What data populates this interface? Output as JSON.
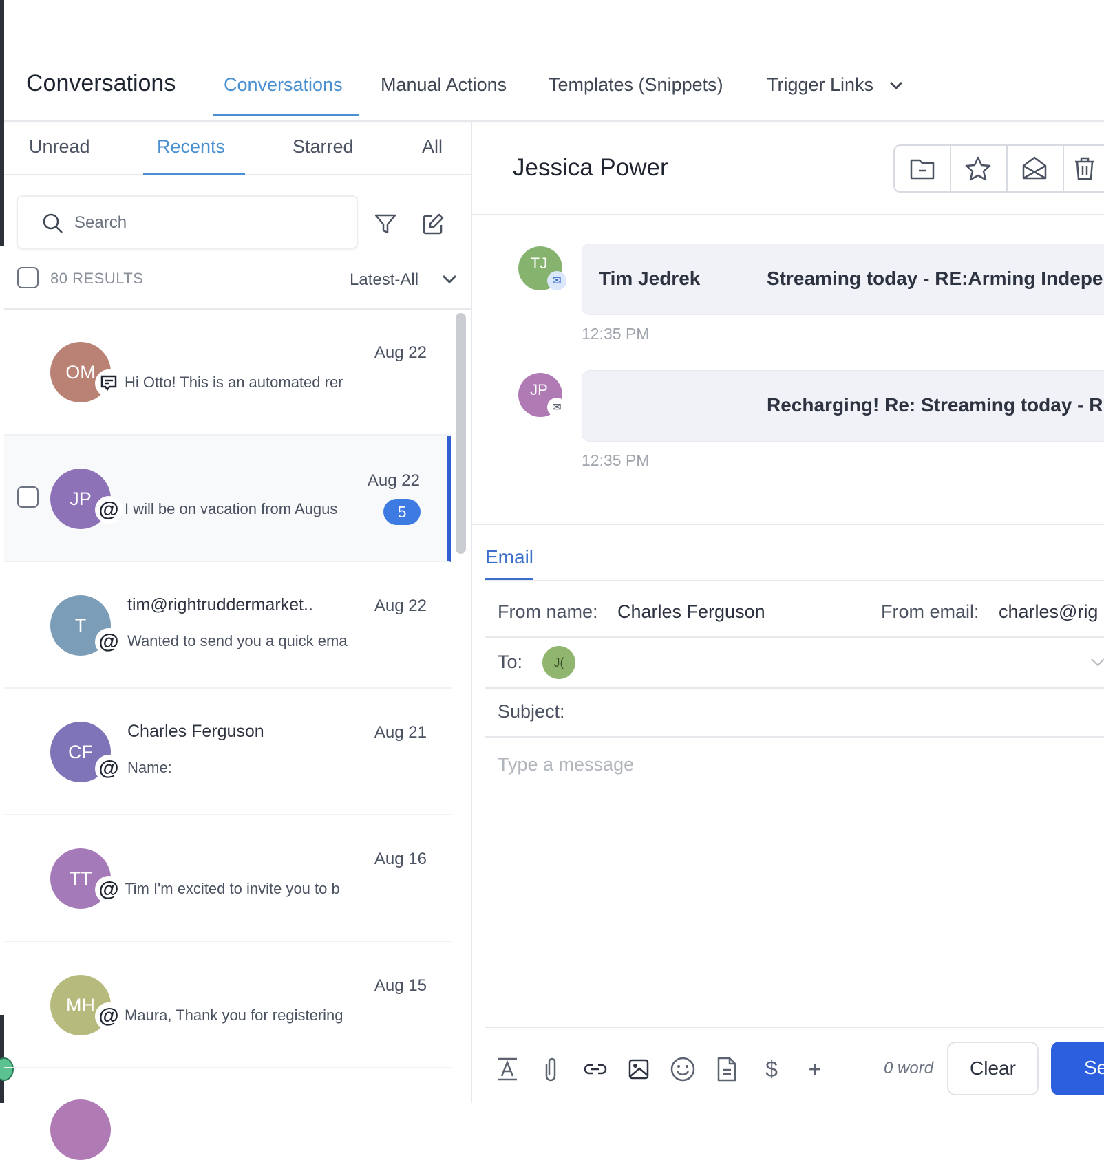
{
  "header": {
    "title": "Conversations",
    "tabs": [
      {
        "label": "Conversations",
        "active": true
      },
      {
        "label": "Manual Actions"
      },
      {
        "label": "Templates (Snippets)"
      },
      {
        "label": "Trigger Links"
      }
    ]
  },
  "left": {
    "subtabs": [
      {
        "label": "Unread"
      },
      {
        "label": "Recents",
        "active": true
      },
      {
        "label": "Starred"
      },
      {
        "label": "All"
      }
    ],
    "search_placeholder": "Search",
    "results": "80 RESULTS",
    "sort": "Latest-All",
    "items": [
      {
        "initials": "OM",
        "color": "#b98274",
        "channel": "sms-icon",
        "name": "",
        "preview": "Hi Otto! This is an automated rer",
        "date": "Aug 22"
      },
      {
        "initials": "JP",
        "color": "#8e72b8",
        "channel": "at-icon",
        "name": "",
        "preview": "I will be on vacation from Augus",
        "date": "Aug 22",
        "unread": "5",
        "selected": true
      },
      {
        "initials": "T",
        "color": "#7b9db8",
        "channel": "at-icon",
        "name": "tim@rightruddermarket..",
        "preview": "Wanted to send you a quick ema",
        "date": "Aug 22"
      },
      {
        "initials": "CF",
        "color": "#7f74b8",
        "channel": "at-icon",
        "name": "Charles Ferguson",
        "preview": "Name:",
        "date": "Aug 21"
      },
      {
        "initials": "TT",
        "color": "#a57ab8",
        "channel": "at-icon",
        "name": "",
        "preview": "Tim I'm excited to invite you to b",
        "date": "Aug 16"
      },
      {
        "initials": "MH",
        "color": "#b6bb7d",
        "channel": "at-icon",
        "name": "",
        "preview": "Maura, Thank you for registering",
        "date": "Aug 15"
      }
    ]
  },
  "conversation": {
    "contact": "Jessica Power",
    "actions": [
      "folder-icon",
      "star-icon",
      "mail-open-icon",
      "trash-icon"
    ],
    "messages": [
      {
        "initials": "TJ",
        "color": "#86b46e",
        "sender": "Tim Jedrek",
        "subject": "Streaming today - RE:Arming Indepe",
        "time": "12:35 PM"
      },
      {
        "initials": "JP",
        "color": "#b07ab5",
        "sender": "",
        "subject": "Recharging! Re: Streaming today - R",
        "time": "12:35 PM"
      }
    ]
  },
  "composer": {
    "tab": "Email",
    "from_name_label": "From name:",
    "from_name": "Charles Ferguson",
    "from_email_label": "From email:",
    "from_email": "charles@rig",
    "to_label": "To:",
    "to_initials": "J(",
    "subject_label": "Subject:",
    "message_placeholder": "Type a message",
    "word_count": "0 word",
    "clear": "Clear",
    "send": "Se",
    "accent": "#2b5fdd"
  }
}
